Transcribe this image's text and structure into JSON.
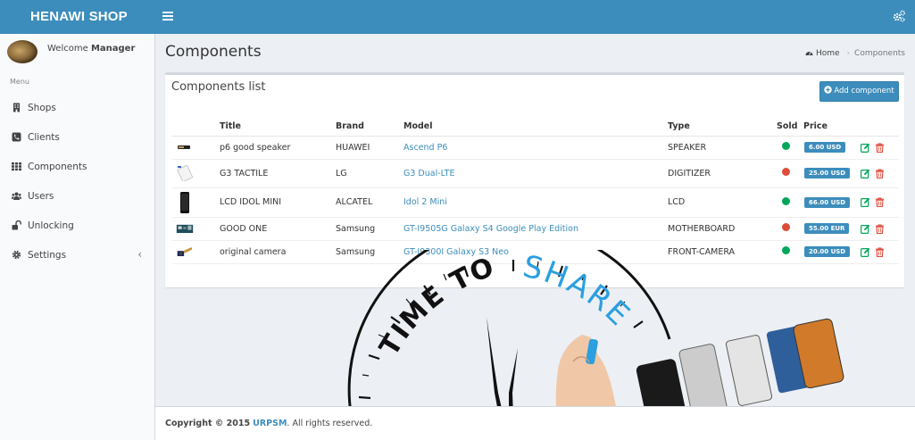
{
  "app": {
    "logo": "HENAWI SHOP"
  },
  "user": {
    "welcome_prefix": "Welcome",
    "name": "Manager"
  },
  "sidebar": {
    "menu_header": "Menu",
    "items": [
      {
        "label": "Shops",
        "icon": "building-icon"
      },
      {
        "label": "Clients",
        "icon": "phone-square-icon"
      },
      {
        "label": "Components",
        "icon": "grid-icon"
      },
      {
        "label": "Users",
        "icon": "users-icon"
      },
      {
        "label": "Unlocking",
        "icon": "unlock-icon"
      },
      {
        "label": "Settings",
        "icon": "gear-icon",
        "chevron": "‹"
      }
    ]
  },
  "page": {
    "title": "Components",
    "breadcrumb": {
      "home": "Home",
      "current": "Components"
    }
  },
  "box": {
    "title": "Components list",
    "add_button": "Add component"
  },
  "table": {
    "columns": [
      "",
      "Title",
      "Brand",
      "Model",
      "Type",
      "Sold",
      "Price",
      ""
    ],
    "rows": [
      {
        "title": "p6 good speaker",
        "brand": "HUAWEI",
        "model": "Ascend P6",
        "type": "SPEAKER",
        "sold": "green",
        "price": "6.00 USD"
      },
      {
        "title": "G3 TACTILE",
        "brand": "LG",
        "model": "G3 Dual-LTE",
        "type": "DIGITIZER",
        "sold": "red",
        "price": "25.00 USD"
      },
      {
        "title": "LCD IDOL MINI",
        "brand": "ALCATEL",
        "model": "Idol 2 Mini",
        "type": "LCD",
        "sold": "green",
        "price": "66.00 USD"
      },
      {
        "title": "GOOD ONE",
        "brand": "Samsung",
        "model": "GT-I9505G Galaxy S4 Google Play Edition",
        "type": "MOTHERBOARD",
        "sold": "red",
        "price": "55.00 EUR"
      },
      {
        "title": "original camera",
        "brand": "Samsung",
        "model": "GT-I9300I Galaxy S3 Neo",
        "type": "FRONT-CAMERA",
        "sold": "green",
        "price": "20.00 USD"
      }
    ]
  },
  "decor": {
    "clock_text_1": "TIME TO",
    "clock_text_2": "SHARE"
  },
  "footer": {
    "copyright": "Copyright © 2015",
    "brand": "URPSM",
    "rights": ". All rights reserved."
  },
  "colors": {
    "primary": "#3c8dbc",
    "green": "#00a65a",
    "red": "#dd4b39",
    "background": "#ecf0f5"
  }
}
